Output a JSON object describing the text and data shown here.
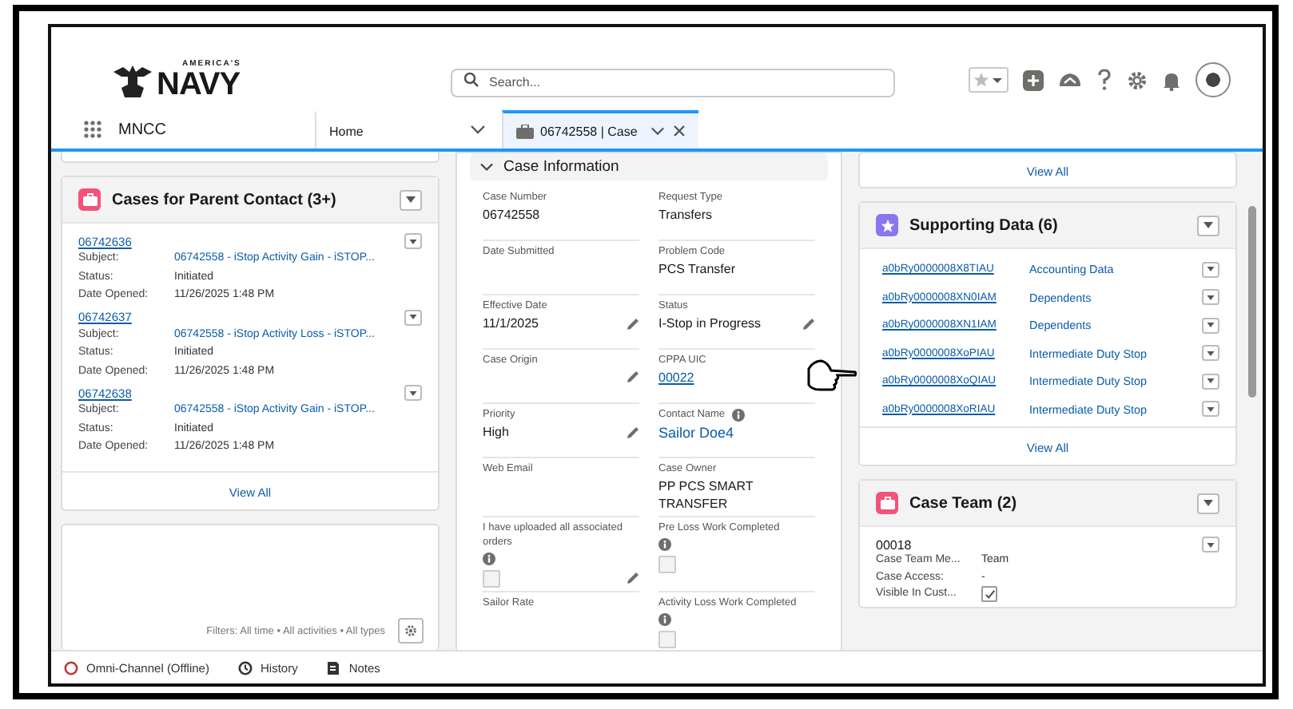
{
  "header": {
    "logo_top": "AMERICA'S",
    "logo_main": "NAVY",
    "search": {
      "placeholder": "Search..."
    }
  },
  "nav": {
    "app_name": "MNCC",
    "tabs": [
      {
        "label": "Home",
        "selected": false,
        "kind": "home"
      },
      {
        "label": "06742558 | Case",
        "selected": true,
        "kind": "record"
      }
    ]
  },
  "left": {
    "cases_card": {
      "title": "Cases for Parent Contact (3+)",
      "items": [
        {
          "number": "06742636",
          "fields": [
            {
              "label": "Subject:",
              "value": "06742558 - iStop Activity Gain - iSTOP...",
              "kind": "link"
            },
            {
              "label": "Status:",
              "value": "Initiated",
              "kind": "text"
            },
            {
              "label": "Date Opened:",
              "value": "11/26/2025 1:48 PM",
              "kind": "text"
            }
          ]
        },
        {
          "number": "06742637",
          "fields": [
            {
              "label": "Subject:",
              "value": "06742558 - iStop Activity Loss - iSTOP...",
              "kind": "link"
            },
            {
              "label": "Status:",
              "value": "Initiated",
              "kind": "text"
            },
            {
              "label": "Date Opened:",
              "value": "11/26/2025 1:48 PM",
              "kind": "text"
            }
          ]
        },
        {
          "number": "06742638",
          "fields": [
            {
              "label": "Subject:",
              "value": "06742558 - iStop Activity Gain - iSTOP...",
              "kind": "link"
            },
            {
              "label": "Status:",
              "value": "Initiated",
              "kind": "text"
            },
            {
              "label": "Date Opened:",
              "value": "11/26/2025 1:48 PM",
              "kind": "text"
            }
          ]
        }
      ],
      "view_all": "View All"
    },
    "activity_card": {
      "filters": "Filters: All time • All activities • All types"
    }
  },
  "middle": {
    "section": {
      "title": "Case Information",
      "expanded": true,
      "fields": [
        {
          "label": "Case Number",
          "value": "06742558",
          "kind": "text",
          "editable": false,
          "info": false
        },
        {
          "label": "Request Type",
          "value": "Transfers",
          "kind": "text",
          "editable": false,
          "info": false
        },
        {
          "label": "Date Submitted",
          "kind": "text",
          "editable": false,
          "info": false
        },
        {
          "label": "Problem Code",
          "value": "PCS Transfer",
          "kind": "text",
          "editable": false,
          "info": false
        },
        {
          "label": "Effective Date",
          "value": "11/1/2025",
          "kind": "text",
          "editable": true,
          "info": false
        },
        {
          "label": "Status",
          "value": "I-Stop in Progress",
          "kind": "text",
          "editable": true,
          "info": false
        },
        {
          "label": "Case Origin",
          "kind": "text",
          "editable": true,
          "info": false
        },
        {
          "label": "CPPA UIC",
          "value": "00022",
          "kind": "link",
          "editable": false,
          "info": false
        },
        {
          "label": "Priority",
          "value": "High",
          "kind": "text",
          "editable": true,
          "info": false
        },
        {
          "label": "Contact Name",
          "value": "Sailor Doe4",
          "kind": "link",
          "editable": false,
          "info": true
        },
        {
          "label": "Web Email",
          "kind": "text",
          "editable": false,
          "info": false
        },
        {
          "label": "Case Owner",
          "value": "PP PCS SMART TRANSFER",
          "kind": "text",
          "editable": false,
          "info": false
        },
        {
          "label": "I have uploaded all associated orders",
          "kind": "checkbox",
          "checked": false,
          "editable": true,
          "info": true
        },
        {
          "label": "Pre Loss Work Completed",
          "kind": "checkbox",
          "checked": false,
          "editable": false,
          "info": true
        },
        {
          "label": "Sailor Rate",
          "kind": "text",
          "editable": false,
          "info": false
        },
        {
          "label": "Activity Loss Work Completed",
          "kind": "checkbox",
          "checked": false,
          "editable": false,
          "info": true
        }
      ]
    }
  },
  "right": {
    "top_card": {
      "view_all": "View All"
    },
    "supporting_card": {
      "title": "Supporting Data (6)",
      "rows": [
        {
          "id": "a0bRy0000008X8TIAU",
          "type": "Accounting Data"
        },
        {
          "id": "a0bRy0000008XN0IAM",
          "type": "Dependents"
        },
        {
          "id": "a0bRy0000008XN1IAM",
          "type": "Dependents"
        },
        {
          "id": "a0bRy0000008XoPIAU",
          "type": "Intermediate Duty Stop"
        },
        {
          "id": "a0bRy0000008XoQIAU",
          "type": "Intermediate Duty Stop"
        },
        {
          "id": "a0bRy0000008XoRIAU",
          "type": "Intermediate Duty Stop"
        }
      ],
      "view_all": "View All"
    },
    "team_card": {
      "title": "Case Team (2)",
      "item": {
        "number": "00018",
        "fields": [
          {
            "label": "Case Team Me...",
            "value": "Team",
            "kind": "text"
          },
          {
            "label": "Case Access:",
            "value": "-",
            "kind": "text"
          },
          {
            "label": "Visible In Cust...",
            "kind": "checkbox",
            "checked": true
          }
        ]
      }
    }
  },
  "footer": {
    "items": [
      {
        "label": "Omni-Channel (Offline)",
        "kind": "presence"
      },
      {
        "label": "History",
        "kind": "history"
      },
      {
        "label": "Notes",
        "kind": "notes"
      }
    ]
  }
}
